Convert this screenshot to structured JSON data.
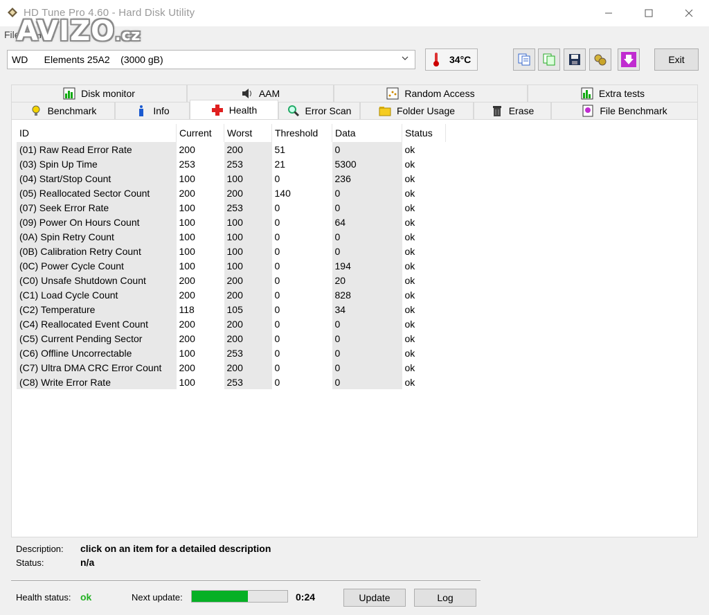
{
  "window": {
    "title": "HD Tune Pro 4.60 - Hard Disk Utility",
    "watermark": "AVIZO",
    "watermark_tld": ".cz"
  },
  "menu": {
    "file": "File",
    "help": "Help"
  },
  "toolbar": {
    "drive": "WD      Elements 25A2    (3000 gB)",
    "temperature": "34°C",
    "exit_label": "Exit"
  },
  "tabs_top": [
    "Disk monitor",
    "AAM",
    "Random Access",
    "Extra tests"
  ],
  "tabs_bottom": [
    "Benchmark",
    "Info",
    "Health",
    "Error Scan",
    "Folder Usage",
    "Erase",
    "File Benchmark"
  ],
  "active_tab": "Health",
  "smart": {
    "headers": [
      "ID",
      "Current",
      "Worst",
      "Threshold",
      "Data",
      "Status"
    ],
    "rows": [
      [
        "(01) Raw Read Error Rate",
        "200",
        "200",
        "51",
        "0",
        "ok"
      ],
      [
        "(03) Spin Up Time",
        "253",
        "253",
        "21",
        "5300",
        "ok"
      ],
      [
        "(04) Start/Stop Count",
        "100",
        "100",
        "0",
        "236",
        "ok"
      ],
      [
        "(05) Reallocated Sector Count",
        "200",
        "200",
        "140",
        "0",
        "ok"
      ],
      [
        "(07) Seek Error Rate",
        "100",
        "253",
        "0",
        "0",
        "ok"
      ],
      [
        "(09) Power On Hours Count",
        "100",
        "100",
        "0",
        "64",
        "ok"
      ],
      [
        "(0A) Spin Retry Count",
        "100",
        "100",
        "0",
        "0",
        "ok"
      ],
      [
        "(0B) Calibration Retry Count",
        "100",
        "100",
        "0",
        "0",
        "ok"
      ],
      [
        "(0C) Power Cycle Count",
        "100",
        "100",
        "0",
        "194",
        "ok"
      ],
      [
        "(C0) Unsafe Shutdown Count",
        "200",
        "200",
        "0",
        "20",
        "ok"
      ],
      [
        "(C1) Load Cycle Count",
        "200",
        "200",
        "0",
        "828",
        "ok"
      ],
      [
        "(C2) Temperature",
        "118",
        "105",
        "0",
        "34",
        "ok"
      ],
      [
        "(C4) Reallocated Event Count",
        "200",
        "200",
        "0",
        "0",
        "ok"
      ],
      [
        "(C5) Current Pending Sector",
        "200",
        "200",
        "0",
        "0",
        "ok"
      ],
      [
        "(C6) Offline Uncorrectable",
        "100",
        "253",
        "0",
        "0",
        "ok"
      ],
      [
        "(C7) Ultra DMA CRC Error Count",
        "200",
        "200",
        "0",
        "0",
        "ok"
      ],
      [
        "(C8) Write Error Rate",
        "100",
        "253",
        "0",
        "0",
        "ok"
      ]
    ]
  },
  "details": {
    "description_label": "Description:",
    "description_value": "click on an item for a detailed description",
    "status_label": "Status:",
    "status_value": "n/a"
  },
  "footer": {
    "health_label": "Health status:",
    "health_value": "ok",
    "next_update_label": "Next update:",
    "progress_fraction": 0.59,
    "countdown": "0:24",
    "update_label": "Update",
    "log_label": "Log"
  },
  "colors": {
    "ok_green": "#22b022",
    "progress_green": "#06b025",
    "health_red": "#e02020",
    "erase_purple": "#c02cd0"
  }
}
